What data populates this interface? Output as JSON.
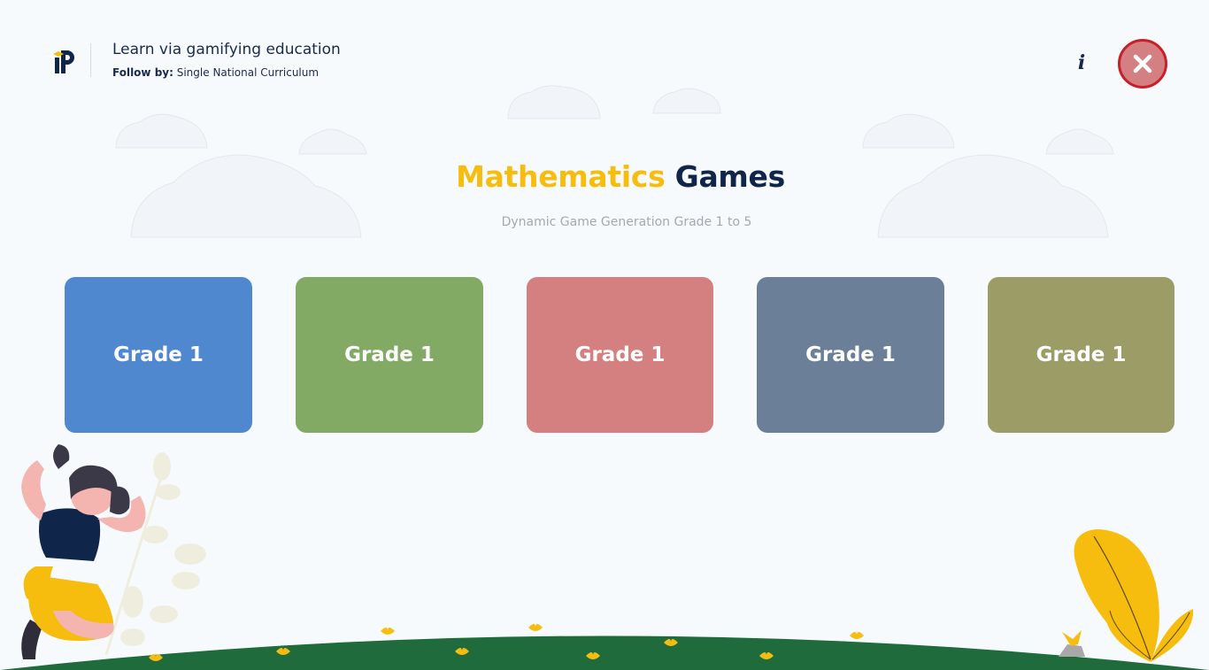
{
  "header": {
    "tagline": "Learn via gamifying education",
    "follow_label": "Follow by:",
    "follow_value": "Single National Curriculum"
  },
  "actions": {
    "info_label": "i",
    "close_icon": "close-icon"
  },
  "hero": {
    "title_accent": "Mathematics",
    "title_rest": "Games",
    "subtitle": "Dynamic Game Generation Grade 1 to 5"
  },
  "grades": [
    {
      "label": "Grade 1",
      "color": "#5088d0"
    },
    {
      "label": "Grade 1",
      "color": "#83aa64"
    },
    {
      "label": "Grade 1",
      "color": "#d47f80"
    },
    {
      "label": "Grade 1",
      "color": "#6b7f99"
    },
    {
      "label": "Grade 1",
      "color": "#9c9d66"
    }
  ],
  "colors": {
    "accent": "#f6bd0e",
    "navy": "#10254a",
    "close": "#d48083",
    "grass": "#1f6b3c"
  }
}
